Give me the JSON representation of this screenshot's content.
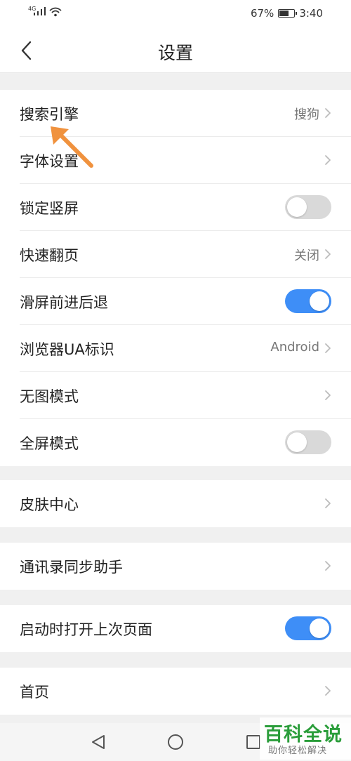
{
  "status_bar": {
    "network": "4G",
    "battery": "67%",
    "battery_level": 0.67,
    "time": "3:40"
  },
  "header": {
    "title": "设置",
    "back_icon": "chevron-left-icon"
  },
  "groups": [
    {
      "items": [
        {
          "label": "搜索引擎",
          "value": "搜狗",
          "type": "link"
        },
        {
          "label": "字体设置",
          "value": "",
          "type": "link"
        },
        {
          "label": "锁定竖屏",
          "type": "toggle",
          "on": false
        },
        {
          "label": "快速翻页",
          "value": "关闭",
          "type": "link"
        },
        {
          "label": "滑屏前进后退",
          "type": "toggle",
          "on": true
        },
        {
          "label": "浏览器UA标识",
          "value": "Android",
          "type": "link"
        },
        {
          "label": "无图模式",
          "value": "",
          "type": "link"
        },
        {
          "label": "全屏模式",
          "type": "toggle",
          "on": false
        }
      ]
    },
    {
      "items": [
        {
          "label": "皮肤中心",
          "value": "",
          "type": "link"
        }
      ]
    },
    {
      "items": [
        {
          "label": "通讯录同步助手",
          "value": "",
          "type": "link"
        }
      ]
    },
    {
      "items": [
        {
          "label": "启动时打开上次页面",
          "type": "toggle",
          "on": true
        }
      ]
    },
    {
      "items": [
        {
          "label": "首页",
          "value": "",
          "type": "link"
        }
      ]
    }
  ],
  "colors": {
    "toggle_on": "#3e8ef7",
    "toggle_off": "#d9d9d9",
    "annotation_arrow": "#f0923e",
    "watermark": "#2a9d3a"
  },
  "watermark": {
    "main": "百科全说",
    "sub": "助你轻松解决"
  },
  "nav_bar": {
    "icons": [
      "back-triangle-icon",
      "home-circle-icon",
      "recents-square-icon"
    ]
  }
}
